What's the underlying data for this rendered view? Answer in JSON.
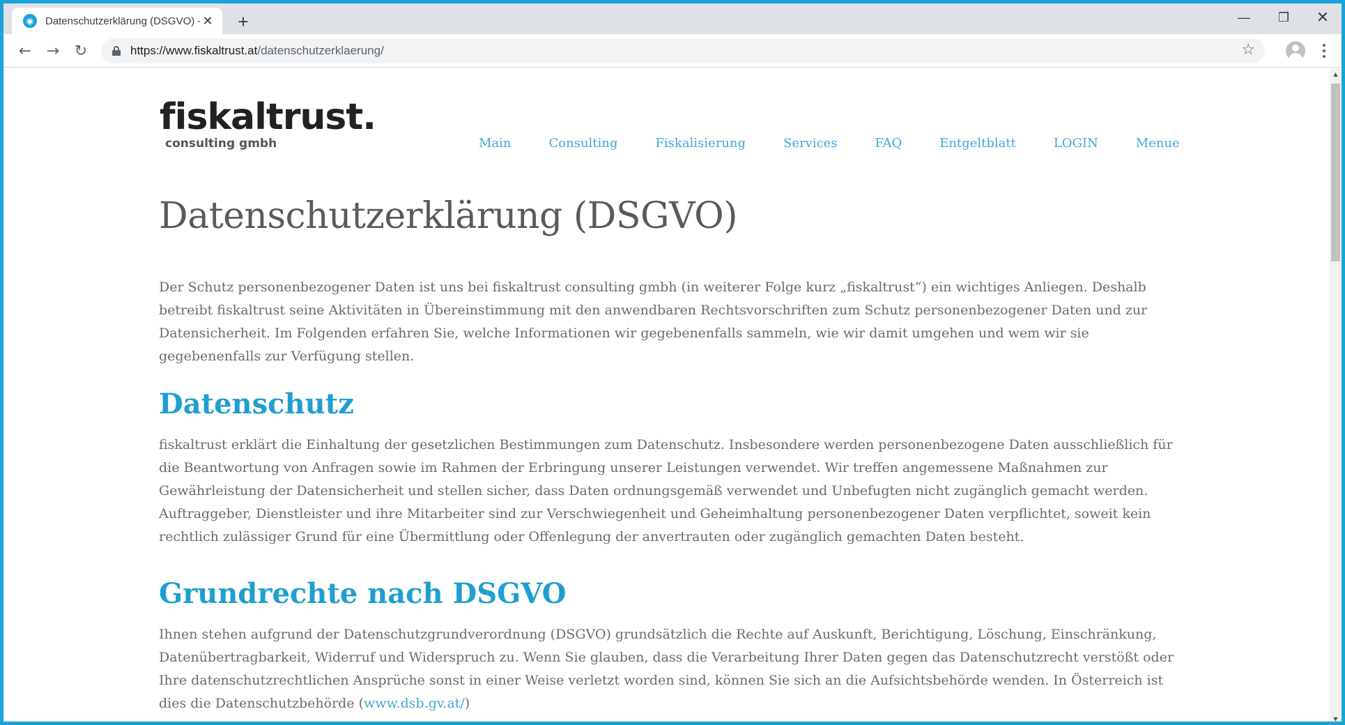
{
  "browser": {
    "tab_title": "Datenschutzerklärung (DSGVO) -",
    "tab_close": "✕",
    "new_tab": "+",
    "window_min": "—",
    "window_max": "❐",
    "window_close": "✕",
    "url_domain": "https://www.fiskaltrust.at",
    "url_path": "/datenschutzerklaerung/",
    "accent_color": "#1aa3d9"
  },
  "site": {
    "logo_main": "fiskaltrust.",
    "logo_sub": "consulting gmbh",
    "nav": [
      "Main",
      "Consulting",
      "Fiskalisierung",
      "Services",
      "FAQ",
      "Entgeltblatt",
      "LOGIN",
      "Menue"
    ],
    "link_color": "#3fa9d4",
    "heading_color": "#1f9fcf"
  },
  "content": {
    "title": "Datenschutzerklärung (DSGVO)",
    "intro": "Der Schutz personenbezogener Daten ist uns bei fiskaltrust consulting gmbh (in weiterer Folge kurz „fiskaltrust“) ein wichtiges Anliegen. Deshalb betreibt fiskaltrust seine Aktivitäten in Übereinstimmung mit den anwendbaren Rechtsvorschriften zum Schutz personenbezogener Daten und zur Datensicherheit. Im Folgenden erfahren Sie, welche Informationen wir gegebenenfalls sammeln, wie wir damit umgehen und wem wir sie gegebenenfalls zur Verfügung stellen.",
    "section1_heading": "Datenschutz",
    "section1_text": "fiskaltrust erklärt die Einhaltung der gesetzlichen Bestimmungen zum Datenschutz. Insbesondere werden personenbezogene Daten ausschließlich für die Beantwortung von Anfragen sowie im Rahmen der Erbringung unserer Leistungen verwendet. Wir treffen angemessene Maßnahmen zur Gewährleistung der Datensicherheit und stellen sicher, dass Daten ordnungsgemäß verwendet und Unbefugten nicht zugänglich gemacht werden. Auftraggeber, Dienstleister und ihre Mitarbeiter sind zur Verschwiegenheit und Geheimhaltung personenbezogener Daten verpflichtet, soweit kein rechtlich zulässiger Grund für eine Übermittlung oder Offenlegung der anvertrauten oder zugänglich gemachten Daten besteht.",
    "section2_heading": "Grundrechte nach DSGVO",
    "section2_text": "Ihnen stehen aufgrund der Datenschutzgrundverordnung (DSGVO) grundsätzlich die Rechte auf Auskunft, Berichtigung, Löschung, Einschränkung, Datenübertragbarkeit, Widerruf und Widerspruch zu. Wenn Sie glauben, dass die Verarbeitung Ihrer Daten gegen das Datenschutzrecht verstößt oder Ihre datenschutzrechtlichen Ansprüche sonst in einer Weise verletzt worden sind, können Sie sich an die Aufsichtsbehörde wenden. In Österreich ist dies die Datenschutzbehörde (",
    "section2_link": "www.dsb.gv.at/",
    "section2_tail": ")"
  }
}
